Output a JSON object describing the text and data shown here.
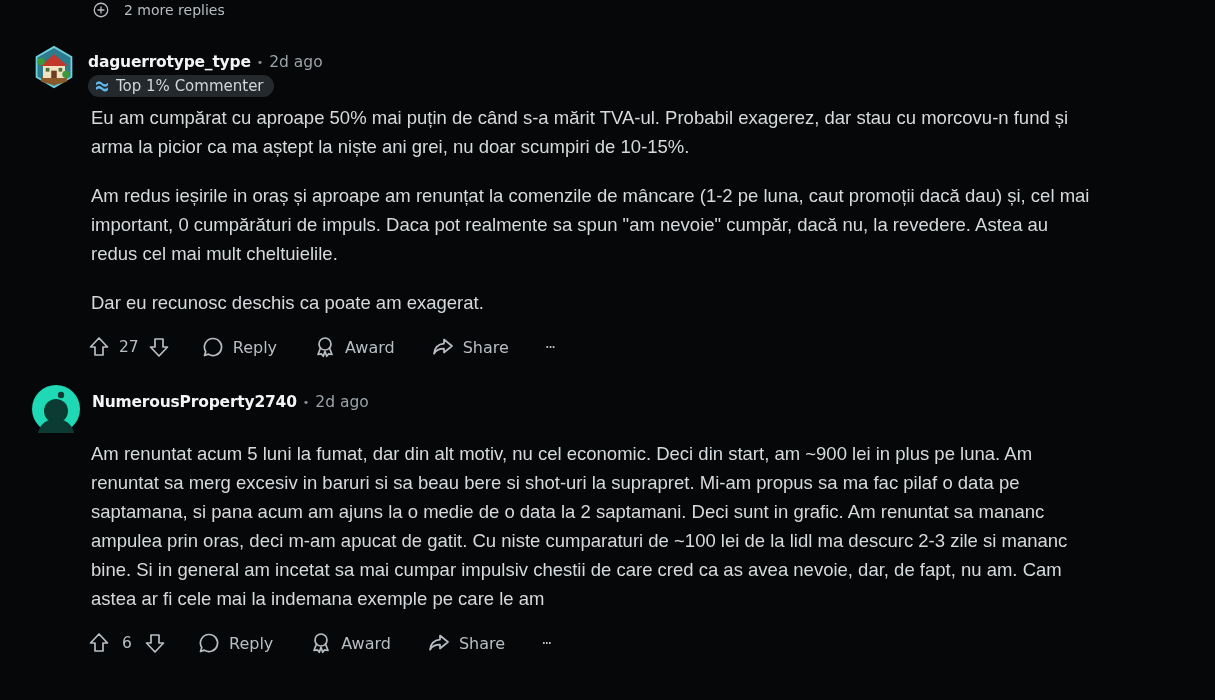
{
  "more_replies": {
    "label": "2 more replies"
  },
  "comments": [
    {
      "kind": "house",
      "author": "daguerrotype_type",
      "separator": "•",
      "time": "2d ago",
      "flair": "Top 1% Commenter",
      "paragraphs": [
        "Eu am cumpărat cu aproape 50% mai puțin de când s-a mărit TVA-ul. Probabil exagerez, dar stau cu morcovu-n fund și arma la picior ca ma aștept la niște ani grei, nu doar scumpiri de 10-15%.",
        "Am redus ieșirile in oraș și aproape am renunțat la comenzile de mâncare (1-2 pe luna, caut promoții dacă dau) și, cel mai important, 0 cumpărături de impuls. Daca pot realmente sa spun \"am nevoie\" cumpăr, dacă nu, la revedere. Astea au redus cel mai mult cheltuielile.",
        "Dar eu recunosc deschis ca poate am exagerat."
      ],
      "score": "27",
      "actions": [
        "Reply",
        "Award",
        "Share"
      ],
      "more": "···"
    },
    {
      "kind": "snoo",
      "author": "NumerousProperty2740",
      "separator": "•",
      "time": "2d ago",
      "paragraphs": [
        "Am renuntat acum 5 luni la fumat, dar din alt motiv, nu cel economic. Deci din start, am ~900 lei in plus pe luna. Am renuntat sa merg excesiv in baruri si sa beau bere si shot-uri la suprapret. Mi-am propus sa ma fac pilaf o data pe saptamana, si pana acum am ajuns la o medie de o data la 2 saptamani. Deci sunt in grafic. Am renuntat sa mananc ampulea prin oras, deci m-am apucat de gatit. Cu niste cumparaturi de ~100 lei de la lidl ma descurc 2-3 zile si mananc bine. Si in general am incetat sa mai cumpar impulsiv chestii de care cred ca as avea nevoie, dar, de fapt, nu am. Cam astea ar fi cele mai la indemana exemple pe care le am"
      ],
      "score": "6",
      "actions": [
        "Reply",
        "Award",
        "Share"
      ],
      "more": "···"
    }
  ]
}
